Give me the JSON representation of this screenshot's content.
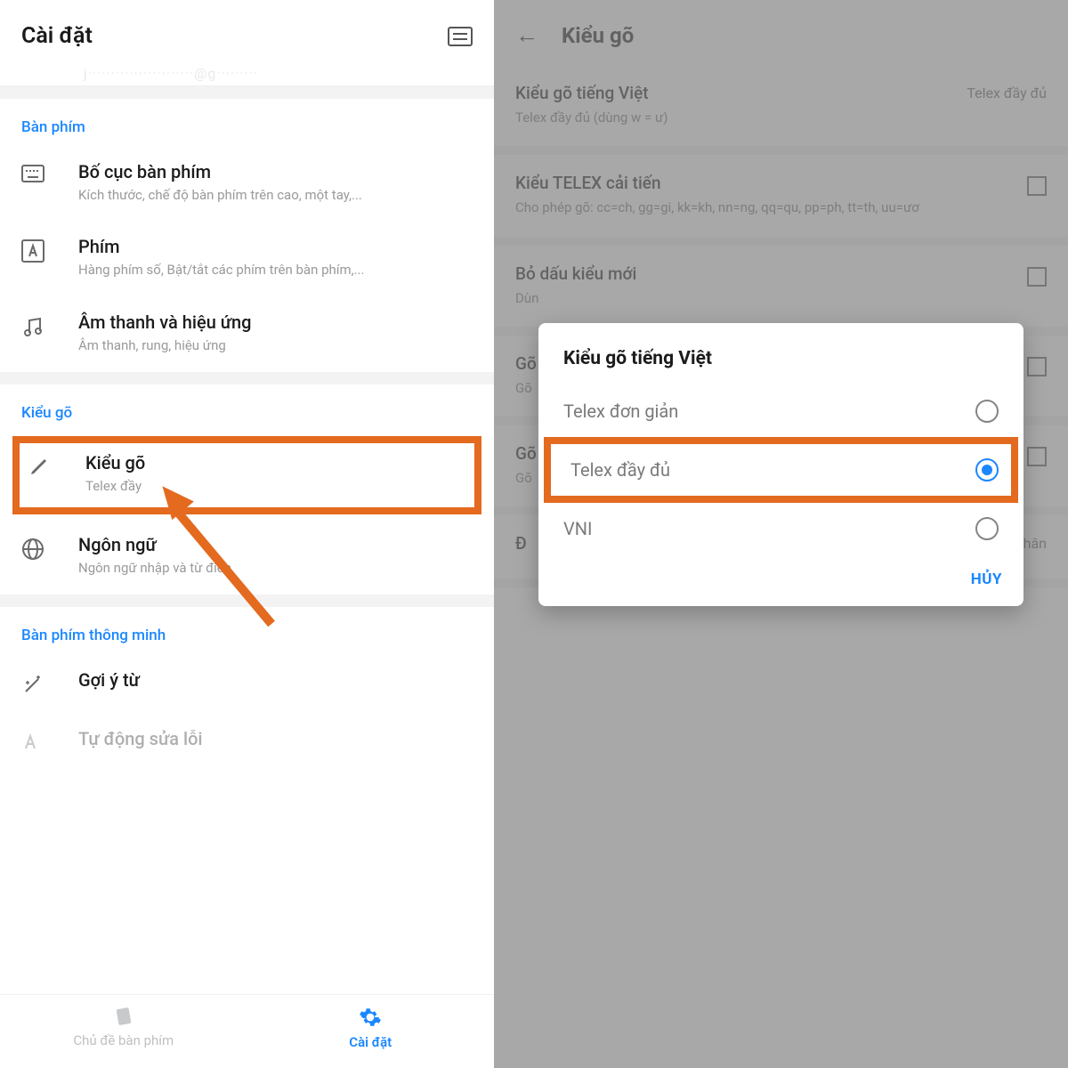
{
  "left": {
    "header_title": "Cài đặt",
    "faded_email": "j·······················@g·········",
    "section_keyboard": "Bàn phím",
    "rows": {
      "layout": {
        "title": "Bố cục bàn phím",
        "sub": "Kích thước, chế độ bàn phím trên cao, một tay,..."
      },
      "keys": {
        "title": "Phím",
        "sub": "Hàng phím số, Bật/tắt các phím trên bàn phím,..."
      },
      "sound": {
        "title": "Âm thanh và hiệu ứng",
        "sub": "Âm thanh, rung, hiệu ứng"
      }
    },
    "section_typing": "Kiểu gõ",
    "typing_row": {
      "title": "Kiểu gõ",
      "sub": "Telex đầy"
    },
    "lang_row": {
      "title": "Ngôn ngữ",
      "sub": "Ngôn ngữ nhập và từ điển"
    },
    "section_smart": "Bàn phím thông minh",
    "suggest_row": {
      "title": "Gợi ý từ"
    },
    "autofix_row": {
      "title": "Tự động sửa lỗi"
    },
    "nav": {
      "themes": "Chủ đề bàn phím",
      "settings": "Cài đặt"
    }
  },
  "right": {
    "header_title": "Kiểu gõ",
    "rows": {
      "vi": {
        "title": "Kiểu gõ tiếng Việt",
        "sub": "Telex đầy đủ (dùng w = ư)",
        "value": "Telex đầy đủ"
      },
      "telex2": {
        "title": "Kiểu TELEX cải tiến",
        "sub": "Cho phép gõ: cc=ch, gg=gi, kk=kh, nn=ng, qq=qu, pp=ph, tt=th, uu=ươ"
      },
      "newmark": {
        "title": "Bỏ dấu kiểu mới",
        "sub": "Dùn"
      },
      "go1": {
        "title": "Gõ",
        "sub": "Gõ"
      },
      "go2": {
        "title": "Gõ",
        "sub": "Gõ"
      },
      "dd": {
        "title": "Đ",
        "value_suffix": "hân"
      }
    },
    "dialog": {
      "title": "Kiểu gõ tiếng Việt",
      "opt1": "Telex đơn giản",
      "opt2": "Telex đầy đủ",
      "opt3": "VNI",
      "cancel": "HỦY"
    }
  }
}
